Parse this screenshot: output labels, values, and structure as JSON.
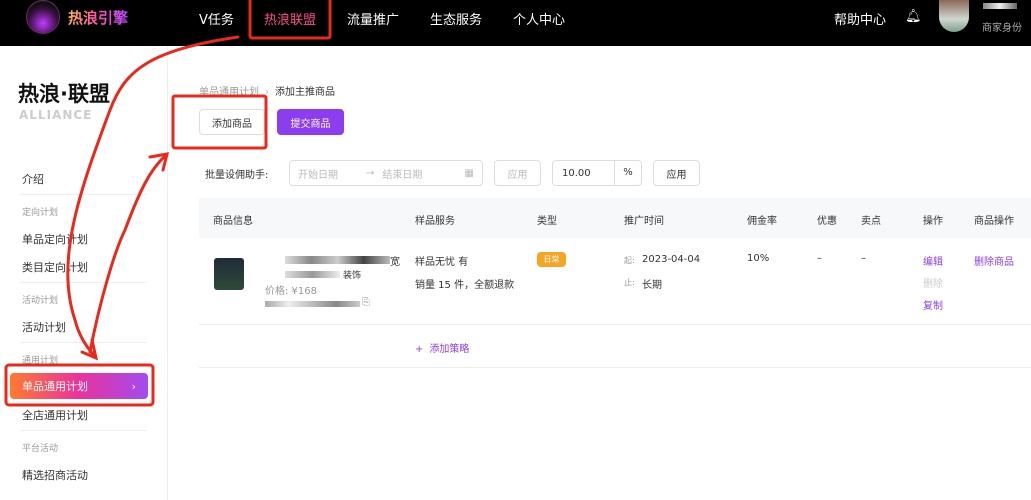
{
  "topnav": {
    "logo_text": "热浪引擎",
    "items": [
      "V任务",
      "热浪联盟",
      "流量推广",
      "生态服务",
      "个人中心"
    ],
    "active": "热浪联盟",
    "help": "帮助中心",
    "role": "商家身份"
  },
  "sidebar": {
    "brand": "热浪·联盟",
    "brand_sub": "ALLIANCE",
    "intro": "介绍",
    "groups": [
      {
        "title": "定向计划",
        "items": [
          "单品定向计划",
          "类目定向计划"
        ]
      },
      {
        "title": "活动计划",
        "items": [
          "活动计划"
        ]
      },
      {
        "title": "通用计划",
        "items": [
          "单品通用计划",
          "全店通用计划"
        ]
      },
      {
        "title": "平台活动",
        "items": [
          "精选招商活动"
        ]
      }
    ],
    "active": "单品通用计划"
  },
  "breadcrumb": {
    "parent": "单品通用计划",
    "current": "添加主推商品"
  },
  "actions": {
    "add": "添加商品",
    "submit": "提交商品"
  },
  "batch": {
    "label": "批量设佣助手:",
    "start_placeholder": "开始日期",
    "end_placeholder": "结束日期",
    "apply1": "应用",
    "rate": "10.00",
    "unit": "%",
    "apply2": "应用"
  },
  "table": {
    "headers": [
      "商品信息",
      "样品服务",
      "类型",
      "推广时间",
      "佣金率",
      "优惠",
      "卖点",
      "操作",
      "商品操作"
    ],
    "row": {
      "title_tail": "装饰",
      "price": "价格: ¥168",
      "sample1": "样品无忧  有",
      "sample2": "销量 15 件，全额退款",
      "type": "日常",
      "start_label": "起:",
      "start": "2023-04-04",
      "end_label": "止:",
      "end": "长期",
      "rate": "10%",
      "discount": "–",
      "selling": "–",
      "ops": [
        "编辑",
        "删除",
        "复制"
      ],
      "item_op": "删除商品"
    },
    "add_strategy": "添加策略"
  },
  "colors": {
    "accent": "#8d3df0",
    "annotation": "#e8291c",
    "tag": "#f5a623"
  }
}
